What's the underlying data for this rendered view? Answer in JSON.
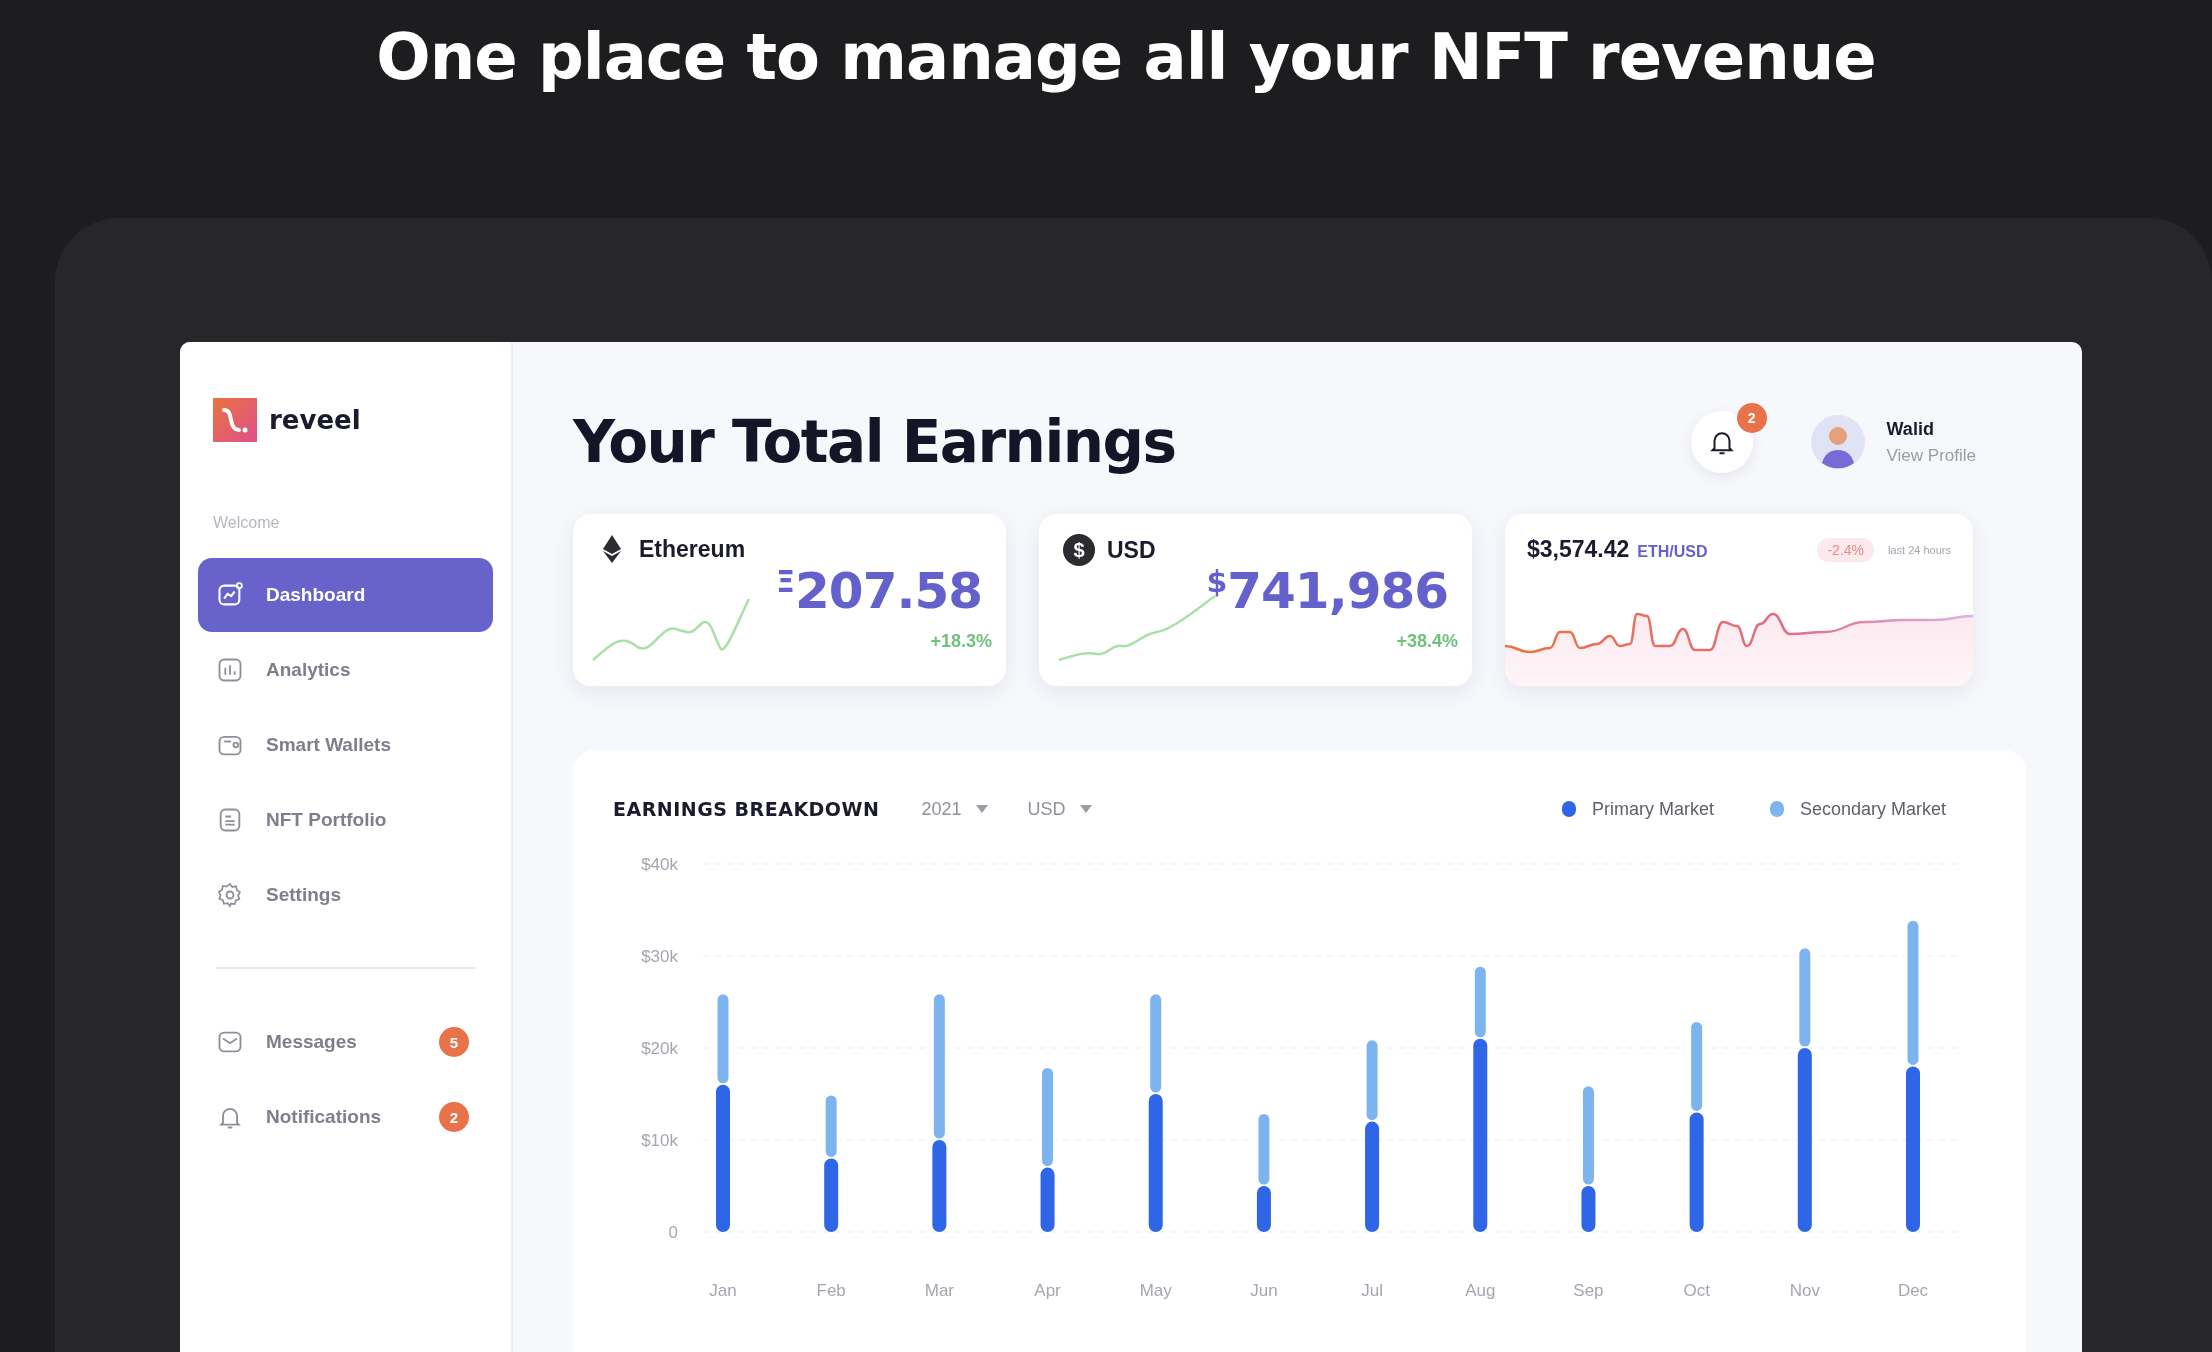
{
  "headline": "One place to manage all your NFT revenue",
  "sidebar": {
    "logo": "reveel",
    "section_label": "Welcome",
    "items": [
      {
        "label": "Dashboard",
        "selected": true
      },
      {
        "label": "Analytics",
        "selected": false
      },
      {
        "label": "Smart Wallets",
        "selected": false
      },
      {
        "label": "NFT Portfolio",
        "selected": false
      },
      {
        "label": "Settings",
        "selected": false
      }
    ],
    "bottom_items": [
      {
        "label": "Messages",
        "badge": "5"
      },
      {
        "label": "Notifications",
        "badge": "2"
      }
    ]
  },
  "header": {
    "title": "Your Total Earnings",
    "notification_badge": "2",
    "user_name": "Walid",
    "profile_link": "View Profile"
  },
  "stat_cards": [
    {
      "kind": "eth",
      "name": "Ethereum",
      "currency": "Ξ",
      "value": "207.58",
      "change": "+18.3%"
    },
    {
      "kind": "usd",
      "name": "USD",
      "icon_text": "$",
      "currency": "$",
      "value": "741,986",
      "change": "+38.4%"
    },
    {
      "kind": "rate",
      "price": "$3,574.42",
      "pair": "ETH/USD",
      "change": "-2.4%",
      "period": "last 24 hours"
    }
  ],
  "breakdown": {
    "title": "EARNINGS BREAKDOWN",
    "filters": [
      "2021",
      "USD"
    ],
    "chart_data": {
      "type": "bar",
      "stacked": true,
      "grid": true,
      "categories": [
        "Jan",
        "Feb",
        "Mar",
        "Apr",
        "May",
        "Jun",
        "Jul",
        "Aug",
        "Sep",
        "Oct",
        "Nov",
        "Dec"
      ],
      "series": [
        {
          "name": "Primary Market",
          "color": "#2f66e8",
          "values": [
            16,
            8,
            10,
            7,
            15,
            5,
            12,
            21,
            5,
            13,
            20,
            18
          ]
        },
        {
          "name": "Secondary Market",
          "color": "#7db4f0",
          "values": [
            10,
            7,
            16,
            11,
            11,
            8,
            9,
            8,
            11,
            10,
            11,
            16
          ]
        }
      ],
      "ylim": [
        0,
        40
      ],
      "yticks": [
        {
          "value": 0,
          "label": "0"
        },
        {
          "value": 10,
          "label": "$10k"
        },
        {
          "value": 20,
          "label": "$20k"
        },
        {
          "value": 30,
          "label": "$30k"
        },
        {
          "value": 40,
          "label": "$40k"
        }
      ]
    }
  }
}
